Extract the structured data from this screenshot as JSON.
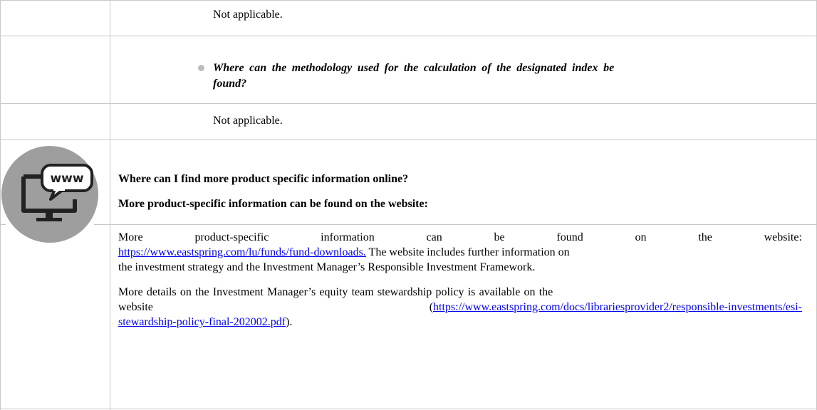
{
  "rows": {
    "row1_text": "Not applicable.",
    "question_line1": "Where can the methodology used for the calculation of the designated index be",
    "question_line2": "found?",
    "row3_text": "Not applicable."
  },
  "section": {
    "icon_label": "www",
    "heading": "Where can I find more product specific information online?",
    "subheading": "More product-specific information can be found on the website:"
  },
  "body": {
    "p1_words": [
      "More",
      "product-specific",
      "information",
      "can",
      "be",
      "found",
      "on",
      "the",
      "website:"
    ],
    "p1_link": "https://www.eastspring.com/lu/funds/fund-downloads.",
    "p1_after_link": " The website includes further information on",
    "p1_line3": "the investment strategy and the Investment Manager’s Responsible Investment Framework.",
    "p2_line1": "More details on the Investment Manager’s equity team stewardship policy is available on the",
    "p2_word": "website",
    "p2_open": "(",
    "p2_link_part1": "https://www.eastspring.com/docs/librariesprovider2/responsible-investments/esi-",
    "p2_link_part2": "stewardship-policy-final-202002.pdf",
    "p2_close": ")."
  },
  "colors": {
    "link": "#0000ee",
    "rule": "#c8c8c8",
    "icon_circle": "#9e9e9e",
    "bullet": "#bdbdbd"
  }
}
